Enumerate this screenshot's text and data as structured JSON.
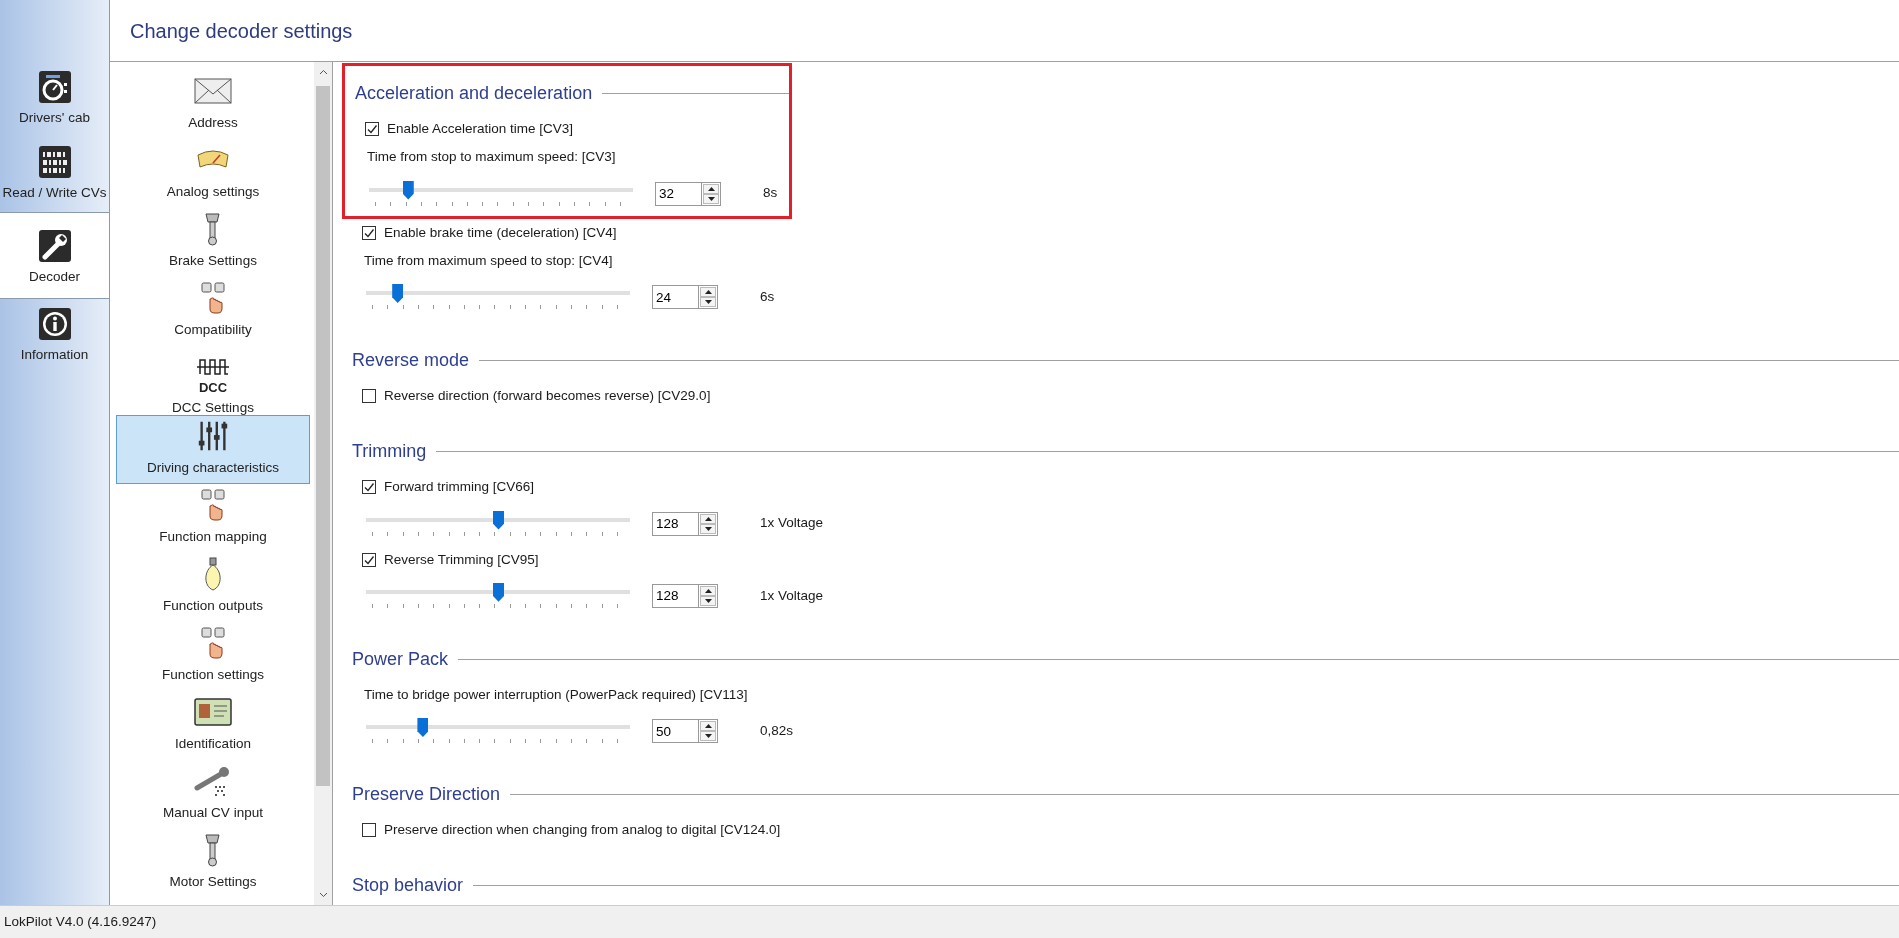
{
  "nav_tabs": [
    {
      "label": "Drivers' cab",
      "selected": false
    },
    {
      "label": "Read / Write CVs",
      "selected": false
    },
    {
      "label": "Decoder",
      "selected": true
    },
    {
      "label": "Information",
      "selected": false
    }
  ],
  "header": {
    "title": "Change decoder settings"
  },
  "categories": [
    {
      "label": "Address",
      "selected": false
    },
    {
      "label": "Analog settings",
      "selected": false
    },
    {
      "label": "Brake Settings",
      "selected": false
    },
    {
      "label": "Compatibility",
      "selected": false
    },
    {
      "label": "DCC Settings",
      "selected": false,
      "icon_text": "DCC"
    },
    {
      "label": "Driving characteristics",
      "selected": true
    },
    {
      "label": "Function mapping",
      "selected": false
    },
    {
      "label": "Function outputs",
      "selected": false
    },
    {
      "label": "Function settings",
      "selected": false
    },
    {
      "label": "Identification",
      "selected": false
    },
    {
      "label": "Manual CV input",
      "selected": false
    },
    {
      "label": "Motor Settings",
      "selected": false
    }
  ],
  "sections": [
    {
      "title": "Acceleration and deceleration",
      "rows": [
        {
          "kind": "checkbox",
          "label": "Enable Acceleration time [CV3]",
          "checked": true,
          "highlighted": true
        },
        {
          "kind": "label",
          "text": "Time from stop to maximum speed: [CV3]",
          "highlighted": true
        },
        {
          "kind": "slider",
          "level": 0.13,
          "value": "32",
          "reading": "8s",
          "highlighted": true
        },
        {
          "kind": "checkbox",
          "label": "Enable brake time (deceleration) [CV4]",
          "checked": true,
          "highlighted": false
        },
        {
          "kind": "label",
          "text": "Time from maximum speed to stop: [CV4]",
          "highlighted": false
        },
        {
          "kind": "slider",
          "level": 0.1,
          "value": "24",
          "reading": "6s",
          "highlighted": false
        }
      ]
    },
    {
      "title": "Reverse mode",
      "rows": [
        {
          "kind": "checkbox",
          "label": "Reverse direction (forward becomes reverse) [CV29.0]",
          "checked": false,
          "highlighted": false
        }
      ]
    },
    {
      "title": "Trimming",
      "rows": [
        {
          "kind": "checkbox",
          "label": "Forward trimming [CV66]",
          "checked": true,
          "highlighted": false
        },
        {
          "kind": "slider",
          "level": 0.5,
          "value": "128",
          "reading": "1x Voltage",
          "highlighted": false
        },
        {
          "kind": "checkbox",
          "label": "Reverse Trimming [CV95]",
          "checked": true,
          "highlighted": false
        },
        {
          "kind": "slider",
          "level": 0.5,
          "value": "128",
          "reading": "1x Voltage",
          "highlighted": false
        }
      ]
    },
    {
      "title": "Power Pack",
      "rows": [
        {
          "kind": "label",
          "text": "Time to bridge power interruption (PowerPack required) [CV113]",
          "highlighted": false
        },
        {
          "kind": "slider",
          "level": 0.2,
          "value": "50",
          "reading": "0,82s",
          "highlighted": false
        }
      ]
    },
    {
      "title": "Preserve Direction",
      "rows": [
        {
          "kind": "checkbox",
          "label": "Preserve direction when changing from analog to digital [CV124.0]",
          "checked": false,
          "highlighted": false
        }
      ]
    },
    {
      "title": "Stop behavior"
    }
  ],
  "status_bar": {
    "text": "LokPilot V4.0 (4.16.9247)"
  }
}
